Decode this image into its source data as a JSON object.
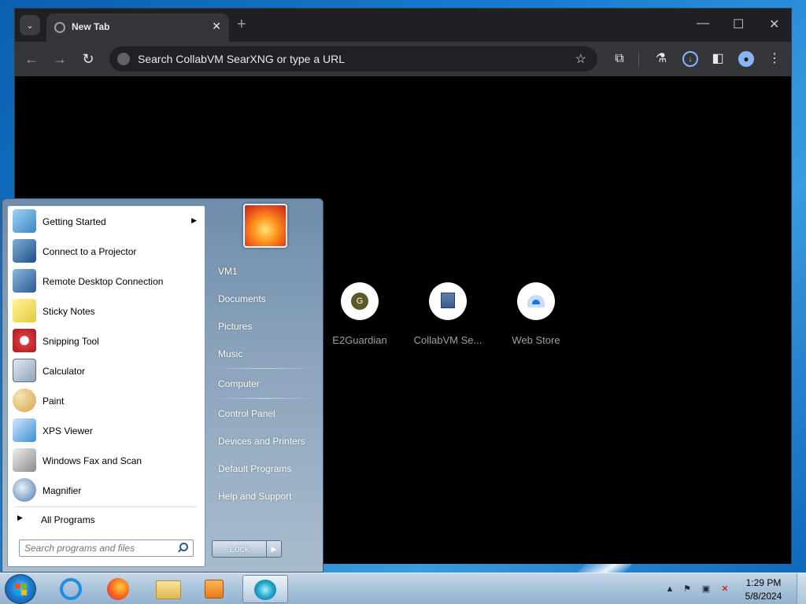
{
  "browser": {
    "tab_title": "New Tab",
    "tab_close": "✕",
    "new_tab": "+",
    "dropdown": "⌄",
    "window": {
      "minimize": "—",
      "maximize": "☐",
      "close": "✕"
    },
    "nav": {
      "back": "←",
      "forward": "→",
      "reload": "↻"
    },
    "omnibox_text": "Search CollabVM SearXNG or type a URL",
    "star": "☆",
    "toolbar_icons": [
      "extensions-icon",
      "labs-icon",
      "download-icon",
      "sidepanel-icon",
      "profile-icon",
      "menu-icon"
    ],
    "shortcuts": [
      {
        "label": "E2Guardian",
        "icon": "e2guardian-icon",
        "letter": "G"
      },
      {
        "label": "CollabVM Se...",
        "icon": "collabvm-icon"
      },
      {
        "label": "Web Store",
        "icon": "web-store-icon"
      }
    ]
  },
  "start_menu": {
    "programs": [
      {
        "label": "Getting Started",
        "icon": "getting-started-icon",
        "submenu": true
      },
      {
        "label": "Connect to a Projector",
        "icon": "projector-icon"
      },
      {
        "label": "Remote Desktop Connection",
        "icon": "remote-desktop-icon"
      },
      {
        "label": "Sticky Notes",
        "icon": "sticky-notes-icon"
      },
      {
        "label": "Snipping Tool",
        "icon": "snipping-tool-icon"
      },
      {
        "label": "Calculator",
        "icon": "calculator-icon"
      },
      {
        "label": "Paint",
        "icon": "paint-icon"
      },
      {
        "label": "XPS Viewer",
        "icon": "xps-viewer-icon"
      },
      {
        "label": "Windows Fax and Scan",
        "icon": "fax-scan-icon"
      },
      {
        "label": "Magnifier",
        "icon": "magnifier-icon"
      }
    ],
    "all_programs": "All Programs",
    "search_placeholder": "Search programs and files",
    "right_items": [
      "VM1",
      "Documents",
      "Pictures",
      "Music",
      "Computer",
      "Control Panel",
      "Devices and Printers",
      "Default Programs",
      "Help and Support"
    ],
    "lock_label": "Lock",
    "lock_arrow": "▶"
  },
  "taskbar": {
    "apps": [
      "internet-explorer-icon",
      "firefox-icon",
      "file-explorer-icon",
      "media-player-icon",
      "active-app-icon"
    ],
    "time": "1:29 PM",
    "date": "5/8/2024",
    "tray": {
      "chevron": "▲",
      "flag": "⚑",
      "network": "▣",
      "volume": "🔇"
    }
  },
  "colors": {
    "browser_bg": "#000000",
    "tabstrip": "#1f2023",
    "toolbar": "#35363a",
    "taskbar": "#a9c2da"
  }
}
